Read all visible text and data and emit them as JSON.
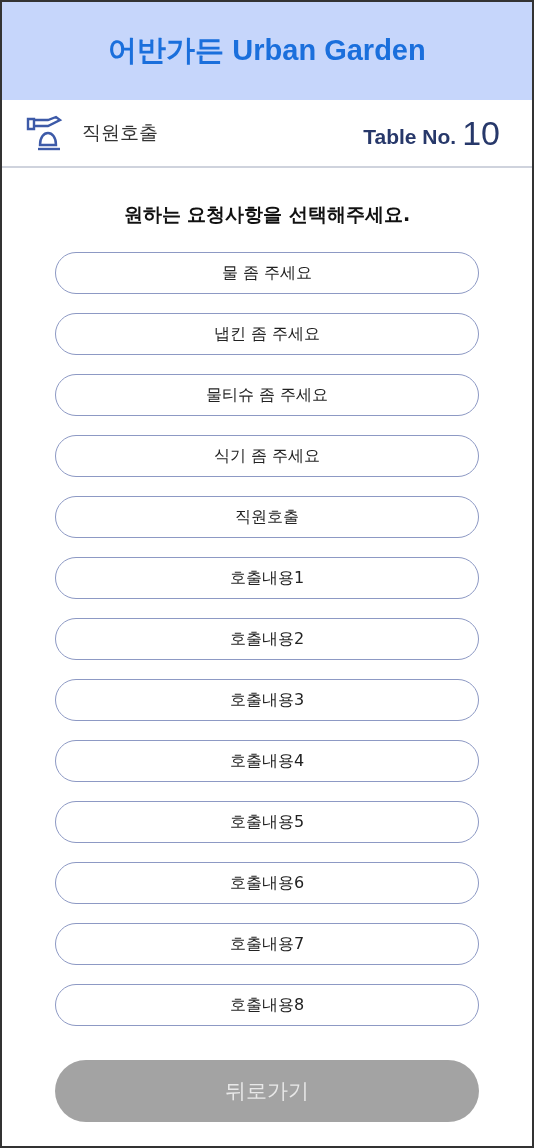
{
  "header": {
    "title": "어반가든 Urban Garden"
  },
  "subbar": {
    "label": "직원호출",
    "table_label": "Table No.",
    "table_number": "10"
  },
  "prompt": "원하는 요청사항을 선택해주세요.",
  "requests": [
    {
      "label": "물 좀 주세요"
    },
    {
      "label": "냅킨 좀 주세요"
    },
    {
      "label": "물티슈 좀 주세요"
    },
    {
      "label": "식기 좀 주세요"
    },
    {
      "label": "직원호출"
    },
    {
      "label": "호출내용1"
    },
    {
      "label": "호출내용2"
    },
    {
      "label": "호출내용3"
    },
    {
      "label": "호출내용4"
    },
    {
      "label": "호출내용5"
    },
    {
      "label": "호출내용6"
    },
    {
      "label": "호출내용7"
    },
    {
      "label": "호출내용8"
    }
  ],
  "back_button": {
    "label": "뒤로가기",
    "disabled": true
  }
}
